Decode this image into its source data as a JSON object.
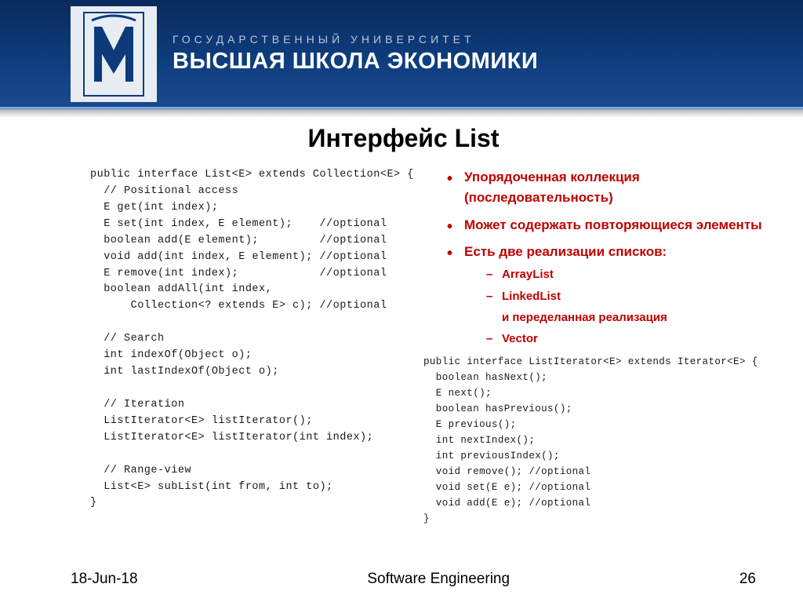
{
  "header": {
    "subtitle": "ГОСУДАРСТВЕННЫЙ УНИВЕРСИТЕТ",
    "title": "ВЫСШАЯ ШКОЛА ЭКОНОМИКИ"
  },
  "page_title": "Интерфейс List",
  "code_left": "public interface List<E> extends Collection<E> {\n  // Positional access\n  E get(int index);\n  E set(int index, E element);    //optional\n  boolean add(E element);         //optional\n  void add(int index, E element); //optional\n  E remove(int index);            //optional\n  boolean addAll(int index,\n      Collection<? extends E> c); //optional\n\n  // Search\n  int indexOf(Object o);\n  int lastIndexOf(Object o);\n\n  // Iteration\n  ListIterator<E> listIterator();\n  ListIterator<E> listIterator(int index);\n\n  // Range-view\n  List<E> subList(int from, int to);\n}",
  "bullets": {
    "b1": "Упорядоченная коллекция (последовательность)",
    "b2": "Может содержать повторяющиеся элементы",
    "b3": "Есть две реализации списков:",
    "sub1": "ArrayList",
    "sub2": "LinkedList",
    "extra": "и переделанная реализация",
    "sub3": "Vector"
  },
  "code_right": "public interface ListIterator<E> extends Iterator<E> {\n  boolean hasNext();\n  E next();\n  boolean hasPrevious();\n  E previous();\n  int nextIndex();\n  int previousIndex();\n  void remove(); //optional\n  void set(E e); //optional\n  void add(E e); //optional\n}",
  "footer": {
    "date": "18-Jun-18",
    "center": "Software Engineering",
    "page": "26"
  }
}
